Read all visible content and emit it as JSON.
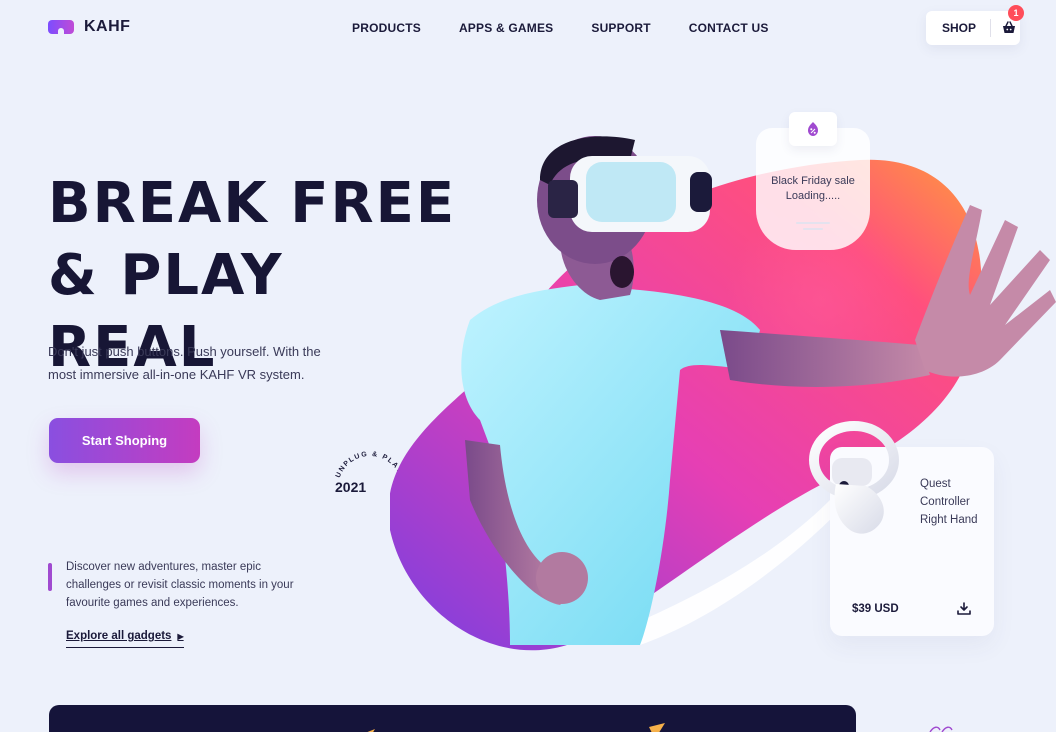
{
  "brand": {
    "name": "KAHF"
  },
  "nav": {
    "items": [
      "PRODUCTS",
      "APPS & GAMES",
      "SUPPORT",
      "CONTACT US"
    ]
  },
  "shop": {
    "label": "SHOP",
    "cart_count": "1"
  },
  "hero": {
    "title_line1": "BREAK FREE",
    "title_line2": "& PLAY REAL",
    "description": "Don't just push buttons. Push yourself. With the most immersive all-in-one KAHF VR system.",
    "cta_label": "Start Shoping"
  },
  "badge": {
    "year": "2021",
    "ring_text": "UNPLUG & PLAY REAL"
  },
  "discover": {
    "text": "Discover new adventures, master epic challenges or revisit classic moments in your favourite games and experiences.",
    "link_label": "Explore all gadgets"
  },
  "sale_card": {
    "line1": "Black Friday sale",
    "line2": "Loading.....",
    "icon": "percent-icon"
  },
  "product": {
    "name": "Quest Controller Right Hand",
    "price": "$39 USD",
    "icon": "download-icon"
  },
  "colors": {
    "accent_start": "#8a4fe0",
    "accent_end": "#c43cc0",
    "dark": "#15143a",
    "background": "#edf1fb",
    "badge": "#ff4d5a"
  }
}
